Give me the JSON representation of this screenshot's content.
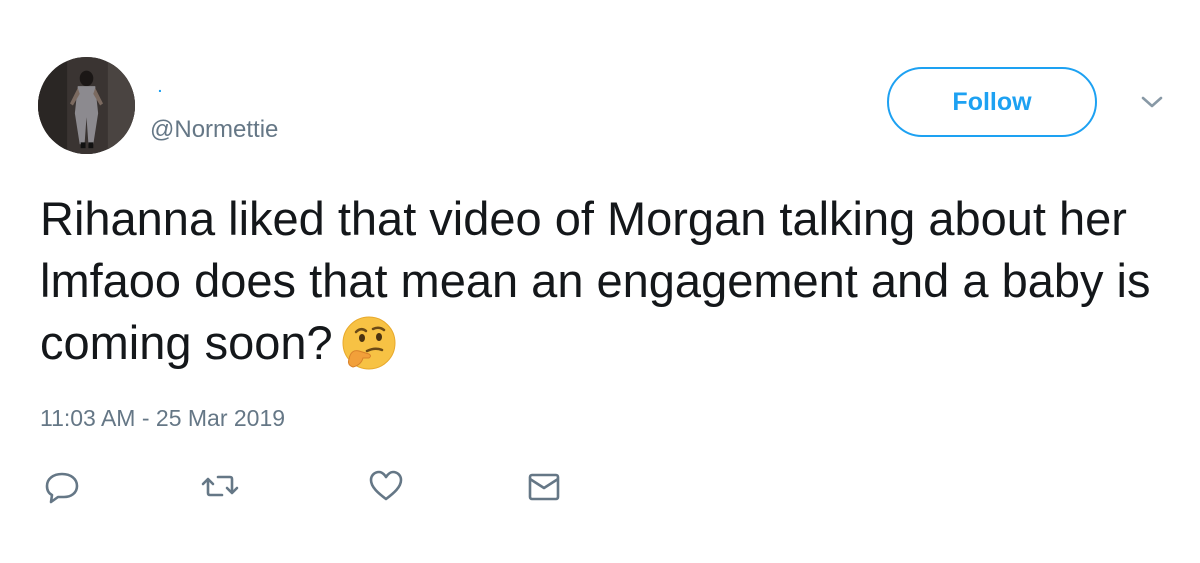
{
  "user": {
    "display_name": ".",
    "handle": "@Normettie"
  },
  "header": {
    "follow_label": "Follow",
    "menu_icon": "chevron-down-icon"
  },
  "tweet": {
    "text": "Rihanna liked that video of Morgan talking about her lmfaoo does that mean an engagement and a baby is coming soon?",
    "emoji": "thinking-face-emoji",
    "timestamp": "11:03 AM - 25 Mar 2019"
  },
  "actions": {
    "reply_icon": "reply-icon",
    "retweet_icon": "retweet-icon",
    "like_icon": "heart-icon",
    "dm_icon": "envelope-icon"
  },
  "colors": {
    "accent": "#1da1f2",
    "text": "#14171a",
    "muted": "#657786"
  }
}
